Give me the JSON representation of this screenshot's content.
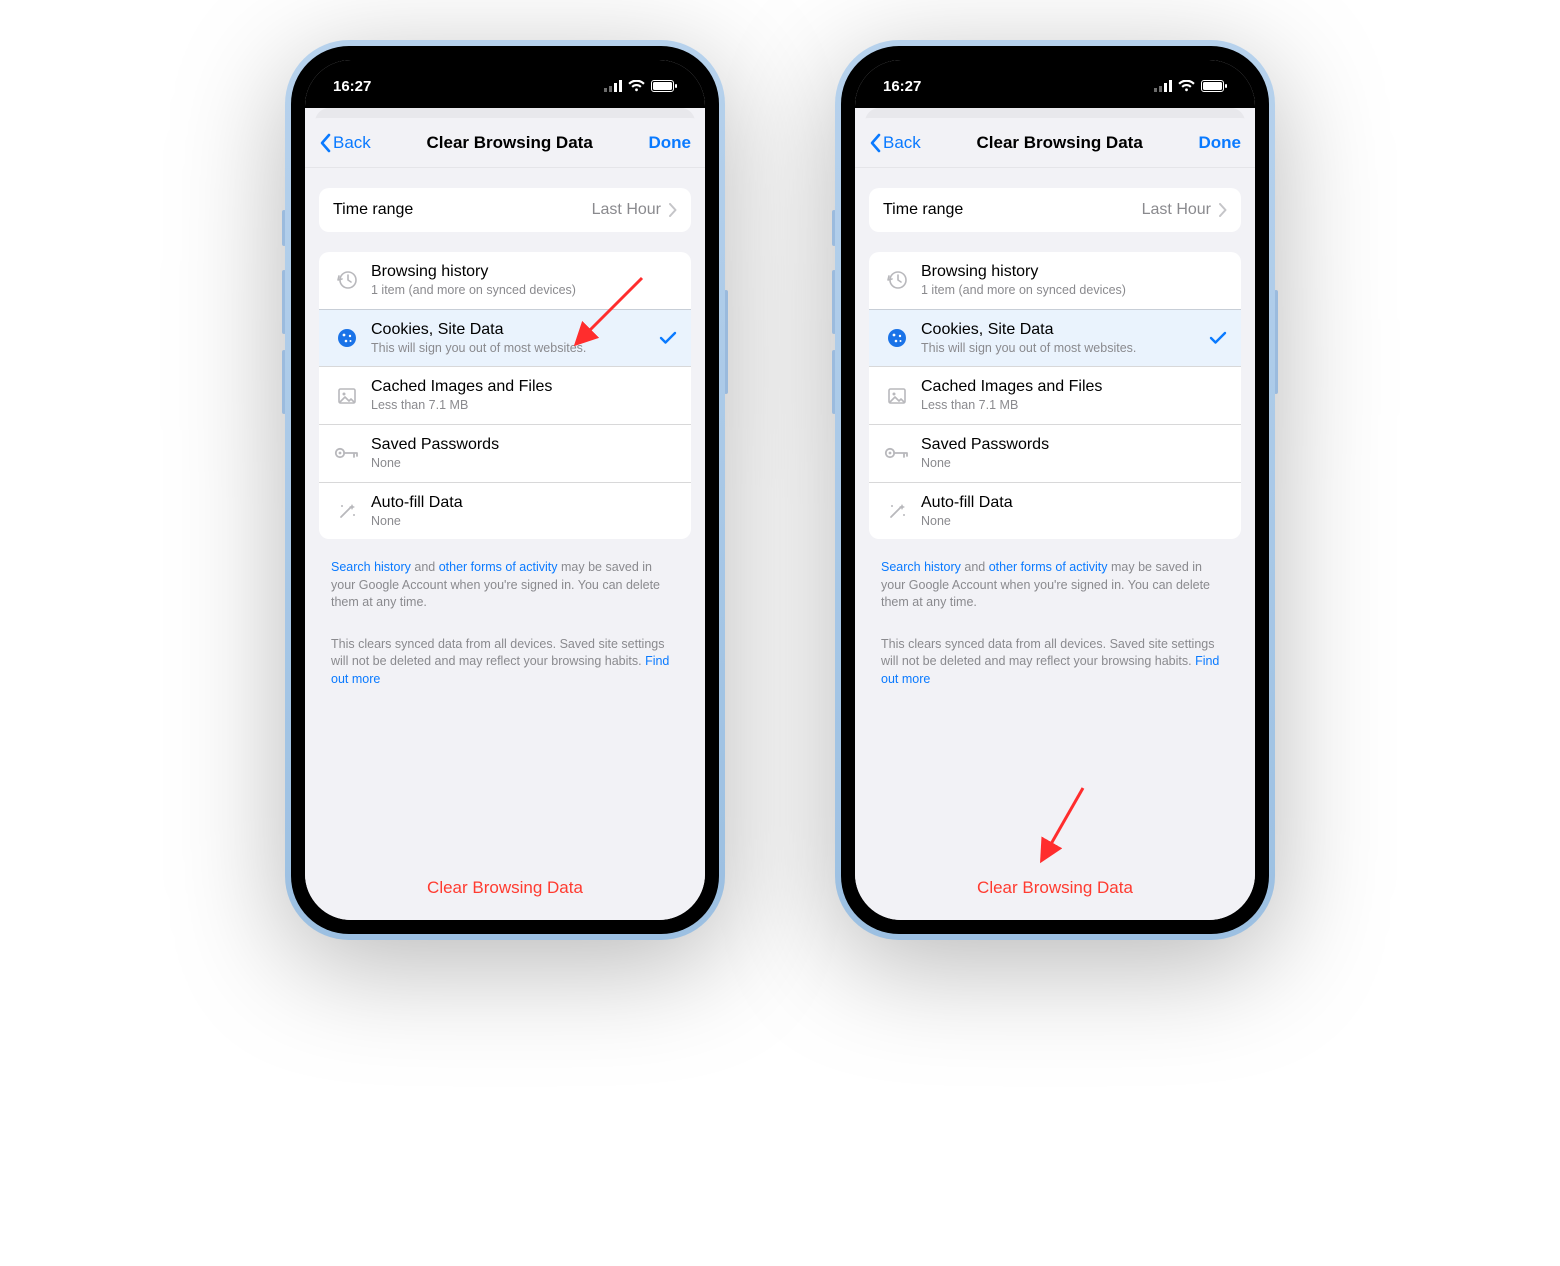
{
  "status": {
    "time": "16:27"
  },
  "nav": {
    "back": "Back",
    "title": "Clear Browsing Data",
    "done": "Done"
  },
  "time_range": {
    "label": "Time range",
    "value": "Last Hour"
  },
  "items": [
    {
      "title": "Browsing history",
      "sub": "1 item (and more on synced devices)",
      "icon": "history",
      "selected": false
    },
    {
      "title": "Cookies, Site Data",
      "sub": "This will sign you out of most websites.",
      "icon": "cookie",
      "selected": true
    },
    {
      "title": "Cached Images and Files",
      "sub": "Less than 7.1 MB",
      "icon": "image",
      "selected": false
    },
    {
      "title": "Saved Passwords",
      "sub": "None",
      "icon": "key",
      "selected": false
    },
    {
      "title": "Auto-fill Data",
      "sub": "None",
      "icon": "wand",
      "selected": false
    }
  ],
  "footer": {
    "link1": "Search history",
    "join1": " and ",
    "link2": "other forms of activity",
    "rest1": " may be saved in your Google Account when you're signed in. You can delete them at any time.",
    "para2a": "This clears synced data from all devices. Saved site settings will not be deleted and may reflect your browsing habits. ",
    "link3": "Find out more"
  },
  "action": "Clear Browsing Data"
}
